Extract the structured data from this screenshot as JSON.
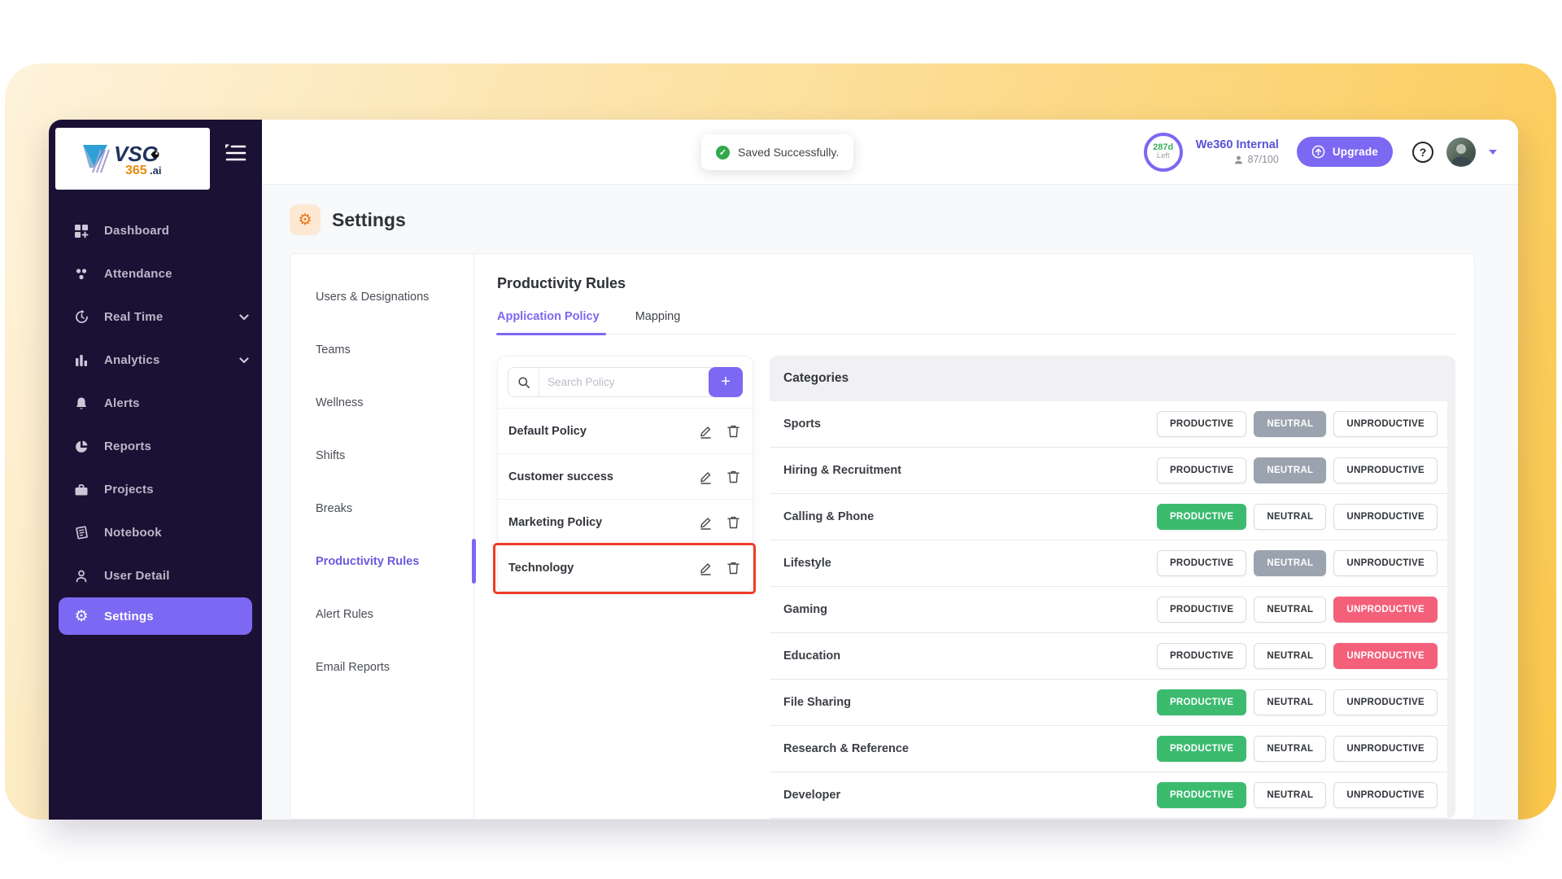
{
  "brand": {
    "logo_main": "VSG",
    "logo_num": "365",
    "logo_tld": ".ai"
  },
  "sidebar": {
    "items": [
      {
        "label": "Dashboard",
        "icon": "dashboard-icon",
        "active": false,
        "chevron": false
      },
      {
        "label": "Attendance",
        "icon": "attendance-icon",
        "active": false,
        "chevron": false
      },
      {
        "label": "Real Time",
        "icon": "realtime-icon",
        "active": false,
        "chevron": true
      },
      {
        "label": "Analytics",
        "icon": "analytics-icon",
        "active": false,
        "chevron": true
      },
      {
        "label": "Alerts",
        "icon": "bell-icon",
        "active": false,
        "chevron": false
      },
      {
        "label": "Reports",
        "icon": "pie-icon",
        "active": false,
        "chevron": false
      },
      {
        "label": "Projects",
        "icon": "briefcase-icon",
        "active": false,
        "chevron": false
      },
      {
        "label": "Notebook",
        "icon": "notebook-icon",
        "active": false,
        "chevron": false
      },
      {
        "label": "User Detail",
        "icon": "user-icon",
        "active": false,
        "chevron": false
      },
      {
        "label": "Settings",
        "icon": "gear-icon",
        "active": true,
        "chevron": false
      }
    ]
  },
  "header": {
    "toast": {
      "message": "Saved Successfully."
    },
    "trial": {
      "days": "287d",
      "label": "Left"
    },
    "org": {
      "name": "We360 Internal",
      "users": "87/100"
    },
    "upgrade_label": "Upgrade",
    "help_label": "?"
  },
  "page": {
    "title": "Settings"
  },
  "settings_nav": {
    "items": [
      {
        "label": "Users & Designations",
        "active": false
      },
      {
        "label": "Teams",
        "active": false
      },
      {
        "label": "Wellness",
        "active": false
      },
      {
        "label": "Shifts",
        "active": false
      },
      {
        "label": "Breaks",
        "active": false
      },
      {
        "label": "Productivity Rules",
        "active": true
      },
      {
        "label": "Alert Rules",
        "active": false
      },
      {
        "label": "Email Reports",
        "active": false
      }
    ]
  },
  "content": {
    "heading": "Productivity Rules",
    "tabs": [
      {
        "label": "Application Policy",
        "active": true
      },
      {
        "label": "Mapping",
        "active": false
      }
    ],
    "search": {
      "placeholder": "Search Policy",
      "add_label": "+"
    },
    "policies": [
      {
        "name": "Default Policy",
        "highlighted": false
      },
      {
        "name": "Customer success",
        "highlighted": false
      },
      {
        "name": "Marketing Policy",
        "highlighted": false
      },
      {
        "name": "Technology",
        "highlighted": true
      }
    ],
    "categories_header": "Categories",
    "state_labels": {
      "productive": "PRODUCTIVE",
      "neutral": "NEUTRAL",
      "unproductive": "UNPRODUCTIVE"
    },
    "categories": [
      {
        "name": "Sports",
        "state": "neutral"
      },
      {
        "name": "Hiring & Recruitment",
        "state": "neutral"
      },
      {
        "name": "Calling & Phone",
        "state": "productive"
      },
      {
        "name": "Lifestyle",
        "state": "neutral"
      },
      {
        "name": "Gaming",
        "state": "unproductive"
      },
      {
        "name": "Education",
        "state": "unproductive"
      },
      {
        "name": "File Sharing",
        "state": "productive"
      },
      {
        "name": "Research & Reference",
        "state": "productive"
      },
      {
        "name": "Developer",
        "state": "productive"
      }
    ]
  },
  "colors": {
    "productive": "#3CBB6F",
    "neutral": "#9AA3AE",
    "unproductive": "#F4607A",
    "accent": "#7C68F2",
    "sidebar_bg": "#1B1134",
    "highlight": "#F03C26",
    "org_name": "#5653D4",
    "gear_orange": "#F0730F",
    "toast_green": "#31A94C"
  }
}
